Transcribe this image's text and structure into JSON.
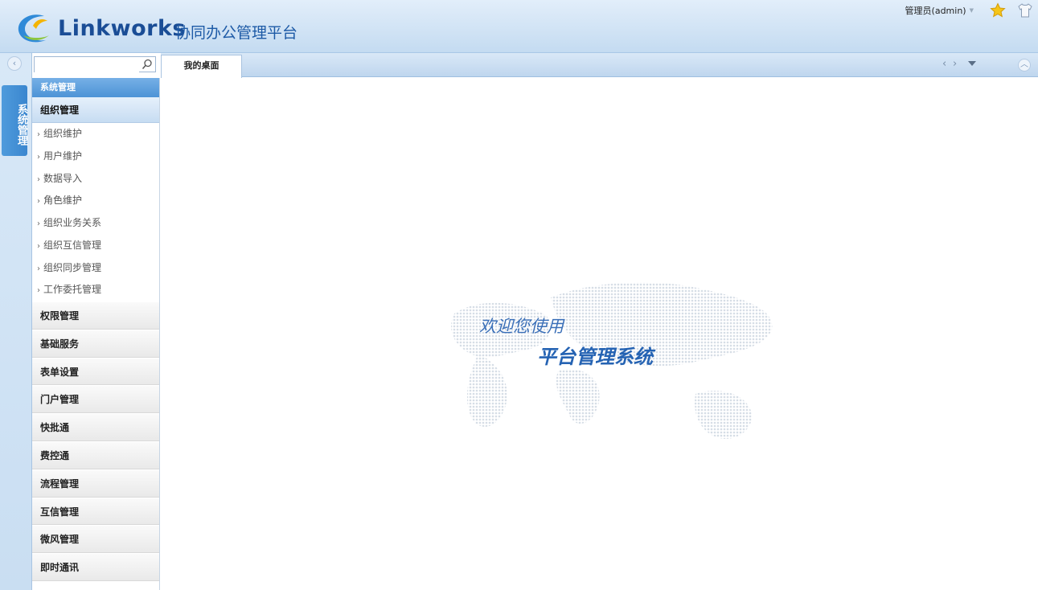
{
  "header": {
    "brand": "Linkworks",
    "subtitle": "协同办公管理平台",
    "user_label": "管理员(admin)",
    "icons": [
      "star-icon",
      "shirt-icon"
    ]
  },
  "rail": {
    "tab_label": "系统管理"
  },
  "search": {
    "placeholder": ""
  },
  "sidebar": {
    "section": "系统管理",
    "active_group": "组织管理",
    "items": [
      "组织维护",
      "用户维护",
      "数据导入",
      "角色维护",
      "组织业务关系",
      "组织互信管理",
      "组织同步管理",
      "工作委托管理"
    ],
    "groups": [
      "权限管理",
      "基础服务",
      "表单设置",
      "门户管理",
      "快批通",
      "费控通",
      "流程管理",
      "互信管理",
      "微风管理",
      "即时通讯"
    ]
  },
  "tabs": {
    "active": "我的桌面"
  },
  "welcome": {
    "line1": "欢迎您使用",
    "line2": "平台管理系统"
  },
  "colors": {
    "accent": "#4d93d6",
    "brand": "#1a4d96"
  }
}
